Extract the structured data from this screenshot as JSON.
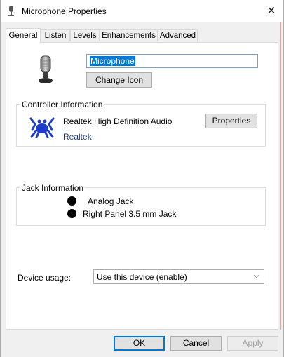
{
  "window": {
    "title": "Microphone Properties",
    "title_icon": "microphone-icon",
    "close_glyph": "✕"
  },
  "tabs": [
    {
      "label": "General",
      "active": true
    },
    {
      "label": "Listen",
      "active": false
    },
    {
      "label": "Levels",
      "active": false
    },
    {
      "label": "Enhancements",
      "active": false
    },
    {
      "label": "Advanced",
      "active": false
    }
  ],
  "general": {
    "device_name": "Microphone",
    "change_icon_label": "Change Icon",
    "controller": {
      "group_label": "Controller Information",
      "name": "Realtek High Definition Audio",
      "vendor_link": "Realtek",
      "properties_label": "Properties",
      "logo_icon": "realtek-crab-icon"
    },
    "jack": {
      "group_label": "Jack Information",
      "items": [
        "Analog Jack",
        "Right Panel 3.5 mm Jack"
      ]
    },
    "device_usage": {
      "label": "Device usage:",
      "value": "Use this device (enable)"
    }
  },
  "footer": {
    "ok_label": "OK",
    "cancel_label": "Cancel",
    "apply_label": "Apply"
  },
  "colors": {
    "accent": "#0078d7",
    "link": "#1f3d8c"
  }
}
